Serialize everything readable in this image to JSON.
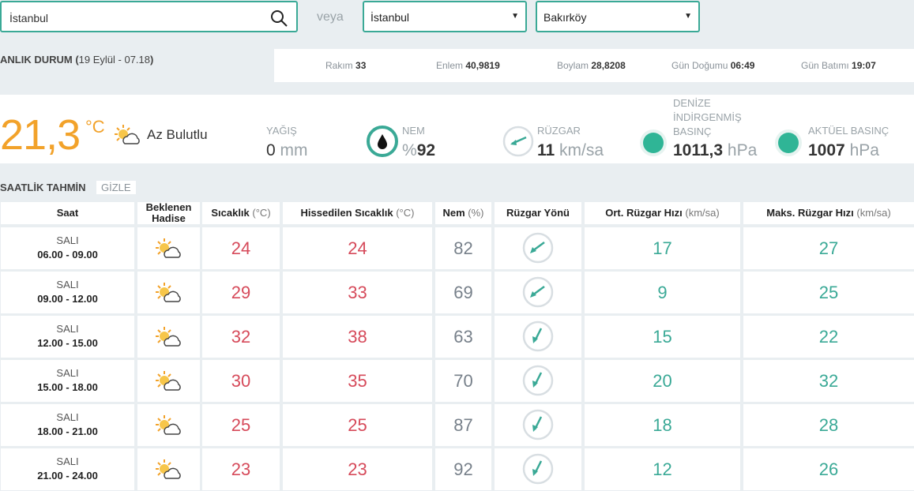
{
  "search": {
    "value": "İstanbul"
  },
  "veya_label": "veya",
  "selects": {
    "province": "İstanbul",
    "district": "Bakırköy"
  },
  "current": {
    "heading": "ANLIK DURUM (",
    "datetime": "19 Eylül - 07.18",
    "heading_close": ")",
    "rakim_label": "Rakım",
    "rakim": "33",
    "enlem_label": "Enlem",
    "enlem": "40,9819",
    "boylam_label": "Boylam",
    "boylam": "28,8208",
    "gundogumu_label": "Gün Doğumu",
    "gundogumu": "06:49",
    "gunbatimi_label": "Gün Batımı",
    "gunbatimi": "19:07",
    "temp": "21,3",
    "temp_unit": "°C",
    "condition": "Az Bulutlu",
    "precip_label": "YAĞIŞ",
    "precip": "0",
    "precip_unit": "mm",
    "humidity_label": "NEM",
    "humidity_prefix": "%",
    "humidity": "92",
    "wind_label": "RÜZGAR",
    "wind": "11",
    "wind_unit": "km/sa",
    "sea_pressure_label_1": "DENİZE",
    "sea_pressure_label_2": "İNDİRGENMİŞ",
    "sea_pressure_label_3": "BASINÇ",
    "sea_pressure": "1011,3",
    "pressure_unit": "hPa",
    "actual_pressure_label": "AKTÜEL BASINÇ",
    "actual_pressure": "1007",
    "accent": "#3aa996",
    "temp_color": "#f2a22a"
  },
  "hourly": {
    "title": "SAATLİK TAHMİN",
    "hide_label": "GİZLE",
    "headers": {
      "saat": "Saat",
      "hadise_1": "Beklenen",
      "hadise_2": "Hadise",
      "sicaklik": "Sıcaklık",
      "sicaklik_unit": "(°C)",
      "hissedilen": "Hissedilen Sıcaklık",
      "hissedilen_unit": "(°C)",
      "nem": "Nem",
      "nem_unit": "(%)",
      "ruzgar_yonu": "Rüzgar Yönü",
      "ort": "Ort. Rüzgar Hızı",
      "ort_unit": "(km/sa)",
      "maks": "Maks. Rüzgar Hızı",
      "maks_unit": "(km/sa)"
    },
    "rows": [
      {
        "day": "SALI",
        "time": "06.00 - 09.00",
        "temp": "24",
        "feels": "24",
        "hum": "82",
        "wind_dir": "ne",
        "avg": "17",
        "max": "27"
      },
      {
        "day": "SALI",
        "time": "09.00 - 12.00",
        "temp": "29",
        "feels": "33",
        "hum": "69",
        "wind_dir": "ne",
        "avg": "9",
        "max": "25"
      },
      {
        "day": "SALI",
        "time": "12.00 - 15.00",
        "temp": "32",
        "feels": "38",
        "hum": "63",
        "wind_dir": "nne",
        "avg": "15",
        "max": "22"
      },
      {
        "day": "SALI",
        "time": "15.00 - 18.00",
        "temp": "30",
        "feels": "35",
        "hum": "70",
        "wind_dir": "nne",
        "avg": "20",
        "max": "32"
      },
      {
        "day": "SALI",
        "time": "18.00 - 21.00",
        "temp": "25",
        "feels": "25",
        "hum": "87",
        "wind_dir": "nne",
        "avg": "18",
        "max": "28"
      },
      {
        "day": "SALI",
        "time": "21.00 - 24.00",
        "temp": "23",
        "feels": "23",
        "hum": "92",
        "wind_dir": "nne",
        "avg": "12",
        "max": "26"
      }
    ]
  }
}
